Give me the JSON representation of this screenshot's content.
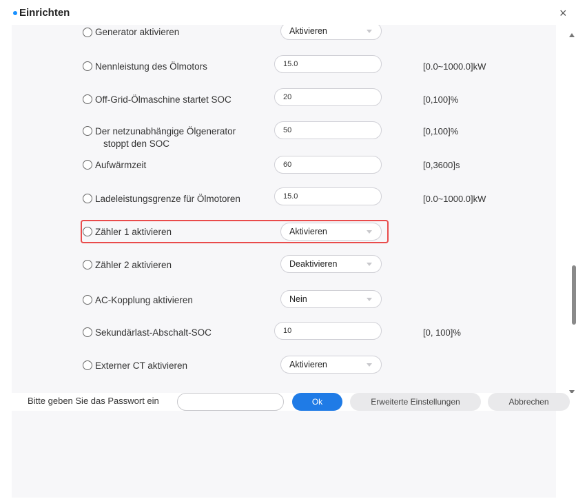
{
  "dialog": {
    "title": "Einrichten",
    "close_glyph": "×"
  },
  "rows": [
    {
      "label": "Generator aktivieren",
      "type": "select",
      "value": "Aktivieren",
      "range": ""
    },
    {
      "label": "Nennleistung des Ölmotors",
      "type": "input",
      "value": "15.0",
      "range": "[0.0~1000.0]kW"
    },
    {
      "label": "Off-Grid-Ölmaschine startet SOC",
      "type": "input",
      "value": "20",
      "range": "[0,100]%"
    },
    {
      "label_line1": "Der netzunabhängige Ölgenerator",
      "label_line2": "stoppt den SOC",
      "type": "input",
      "value": "50",
      "range": "[0,100]%"
    },
    {
      "label": "Aufwärmzeit",
      "type": "input",
      "value": "60",
      "range": "[0,3600]s"
    },
    {
      "label": "Ladeleistungsgrenze für Ölmotoren",
      "type": "input",
      "value": "15.0",
      "range": "[0.0~1000.0]kW"
    },
    {
      "label": "Zähler 1 aktivieren",
      "type": "select",
      "value": "Aktivieren",
      "range": ""
    },
    {
      "label": "Zähler 2 aktivieren",
      "type": "select",
      "value": "Deaktivieren",
      "range": ""
    },
    {
      "label": "AC-Kopplung aktivieren",
      "type": "select",
      "value": "Nein",
      "range": ""
    },
    {
      "label": "Sekundärlast-Abschalt-SOC",
      "type": "input",
      "value": "10",
      "range": "[0, 100]%"
    },
    {
      "label": "Externer CT aktivieren",
      "type": "select",
      "value": "Aktivieren",
      "range": ""
    }
  ],
  "footer": {
    "password_label": "Bitte geben Sie das Passwort ein",
    "password_value": "",
    "ok_label": "Ok",
    "advanced_label": "Erweiterte Einstellungen",
    "cancel_label": "Abbrechen"
  },
  "colors": {
    "accent": "#1f7be6",
    "highlight": "#e94b4b",
    "panel_bg": "#f7f7f9"
  }
}
